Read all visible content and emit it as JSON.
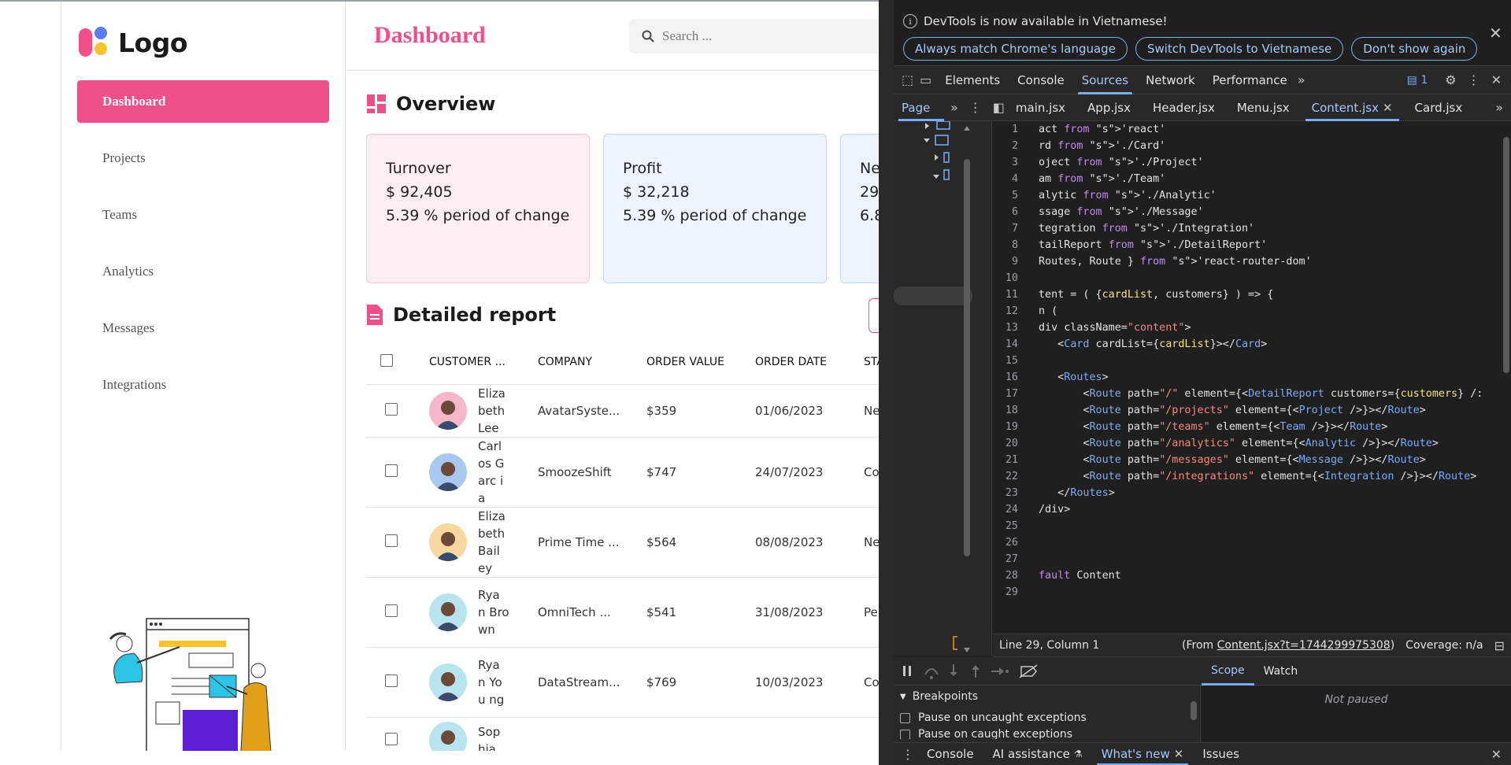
{
  "app": {
    "logo_text": "Logo",
    "page_title": "Dashboard",
    "search_placeholder": "Search ...",
    "nav": [
      {
        "label": "Dashboard",
        "active": true
      },
      {
        "label": "Projects"
      },
      {
        "label": "Teams"
      },
      {
        "label": "Analytics"
      },
      {
        "label": "Messages"
      },
      {
        "label": "Integrations"
      }
    ],
    "overview_title": "Overview",
    "cards": [
      {
        "title": "Turnover",
        "value": "$ 92,405",
        "change": "5.39 % period of change"
      },
      {
        "title": "Profit",
        "value": "$ 32,218",
        "change": "5.39 % period of change"
      },
      {
        "title": "Ne",
        "value": "29",
        "change": "6.8"
      }
    ],
    "report_title": "Detailed report",
    "table": {
      "headers": [
        "CUSTOMER ...",
        "COMPANY",
        "ORDER VALUE",
        "ORDER DATE",
        "STA"
      ],
      "rows": [
        {
          "name": "Eliza beth Lee",
          "company": "AvatarSyste...",
          "value": "$359",
          "date": "01/06/2023",
          "status": "Ne"
        },
        {
          "name": "Carl os Garc ia",
          "company": "SmoozeShift",
          "value": "$747",
          "date": "24/07/2023",
          "status": "Co"
        },
        {
          "name": "Eliza beth Bail ey",
          "company": "Prime Time ...",
          "value": "$564",
          "date": "08/08/2023",
          "status": "Ne"
        },
        {
          "name": "Rya n Bro wn",
          "company": "OmniTech ...",
          "value": "$541",
          "date": "31/08/2023",
          "status": "Per"
        },
        {
          "name": "Rya n You ng",
          "company": "DataStream...",
          "value": "$769",
          "date": "10/03/2023",
          "status": "Co"
        },
        {
          "name": "Sop hia",
          "company": "",
          "value": "",
          "date": "",
          "status": ""
        }
      ]
    }
  },
  "devtools": {
    "info_message": "DevTools is now available in Vietnamese!",
    "info_buttons": [
      "Always match Chrome's language",
      "Switch DevTools to Vietnamese",
      "Don't show again"
    ],
    "main_tabs": [
      "Elements",
      "Console",
      "Sources",
      "Network",
      "Performance"
    ],
    "active_main_tab": "Sources",
    "issues_count": "1",
    "nav_tab": "Page",
    "file_tabs": [
      "main.jsx",
      "App.jsx",
      "Header.jsx",
      "Menu.jsx",
      "Content.jsx",
      "Card.jsx"
    ],
    "active_file": "Content.jsx",
    "status_position": "Line 29, Column 1",
    "status_from_prefix": "(From ",
    "status_from_link": "Content.jsx?t=1744299975308",
    "status_from_suffix": ")",
    "coverage": "Coverage: n/a",
    "breakpoints_label": "Breakpoints",
    "bp_options": [
      "Pause on uncaught exceptions",
      "Pause on caught exceptions"
    ],
    "scope_tabs": [
      "Scope",
      "Watch"
    ],
    "not_paused": "Not paused",
    "drawer_tabs": [
      "Console",
      "AI assistance",
      "What's new",
      "Issues"
    ],
    "code_lines": [
      "act from 'react'",
      "rd from './Card'",
      "oject from './Project'",
      "am from './Team'",
      "alytic from './Analytic'",
      "ssage from './Message'",
      "tegration from './Integration'",
      "tailReport from './DetailReport'",
      "Routes, Route } from 'react-router-dom'",
      "",
      "tent = ( {cardList, customers} ) => {",
      "n (",
      "div className=\"content\">",
      "   <Card cardList={cardList}></Card>",
      "",
      "   <Routes>",
      "       <Route path=\"/\" element={<DetailReport customers={customers} /:",
      "       <Route path=\"/projects\" element={<Project />}></Route>",
      "       <Route path=\"/teams\" element={<Team />}></Route>",
      "       <Route path=\"/analytics\" element={<Analytic />}></Route>",
      "       <Route path=\"/messages\" element={<Message />}></Route>",
      "       <Route path=\"/integrations\" element={<Integration />}></Route>",
      "   </Routes>",
      "/div>",
      "",
      "",
      "",
      "fault Content",
      ""
    ]
  }
}
